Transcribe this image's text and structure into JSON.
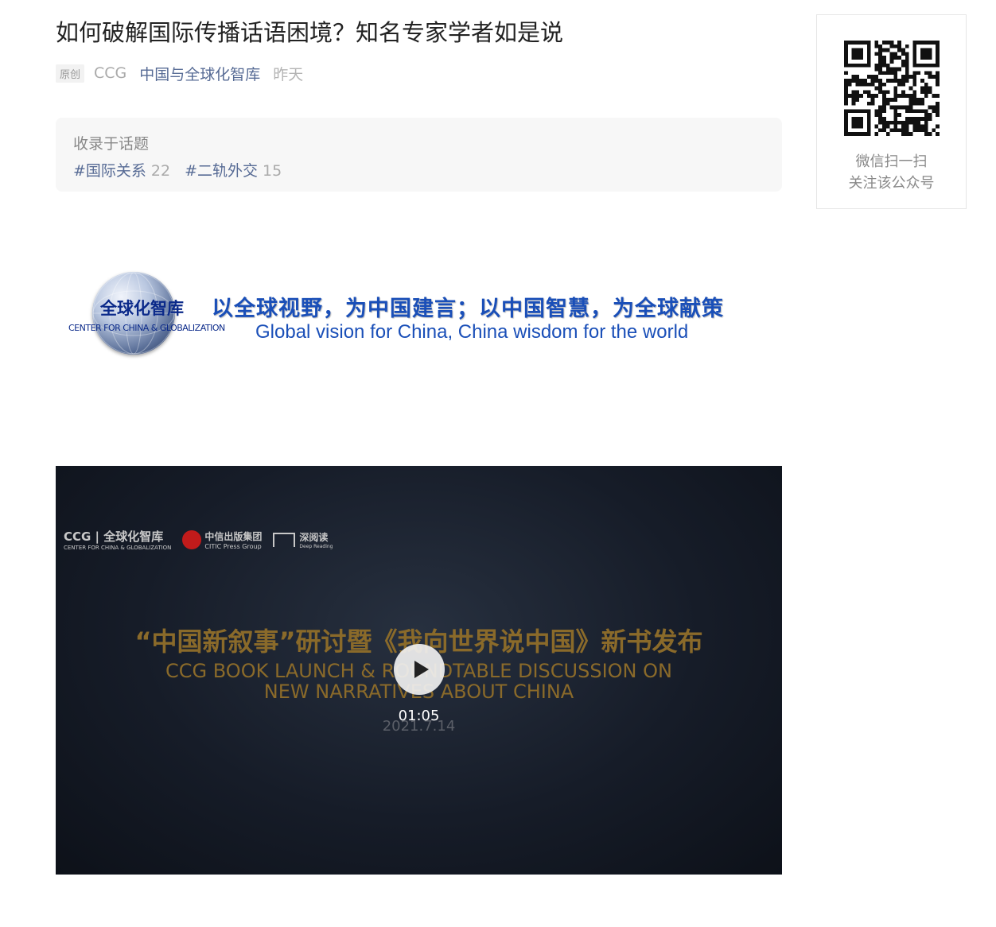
{
  "article": {
    "title": "如何破解国际传播话语困境？知名专家学者如是说",
    "original_badge": "原创",
    "author": "CCG",
    "account": "中国与全球化智库",
    "time": "昨天"
  },
  "topics": {
    "label": "收录于话题",
    "tags": [
      {
        "name": "#国际关系",
        "count": "22"
      },
      {
        "name": "#二轨外交",
        "count": "15"
      }
    ]
  },
  "banner": {
    "globe_text": "全球化智库",
    "globe_en": "CENTER FOR CHINA & GLOBALIZATION",
    "slogan_cn": "以全球视野，为中国建言；以中国智慧，为全球献策",
    "slogan_en": "Global vision for China, China wisdom for the world"
  },
  "video": {
    "logo_ccg": "CCG | 全球化智库",
    "logo_ccg_en": "CENTER FOR CHINA & GLOBALIZATION",
    "logo_citic": "中信出版集团",
    "logo_citic_en": "CITIC Press Group",
    "logo_deep": "深阅读",
    "logo_deep_en": "Deep Reading",
    "title_cn": "“中国新叙事”研讨暨《我向世界说中国》新书发布",
    "title_en_1": "CCG BOOK LAUNCH & ROUNDTABLE DISCUSSION ON",
    "title_en_2": "NEW NARRATIVES ABOUT CHINA",
    "date": "2021.7.14",
    "duration": "01:05"
  },
  "qr": {
    "line1": "微信扫一扫",
    "line2": "关注该公众号"
  },
  "colors": {
    "link": "#576b95",
    "slogan_blue": "#1a4fb8",
    "video_gold": "#8a6a2a"
  }
}
